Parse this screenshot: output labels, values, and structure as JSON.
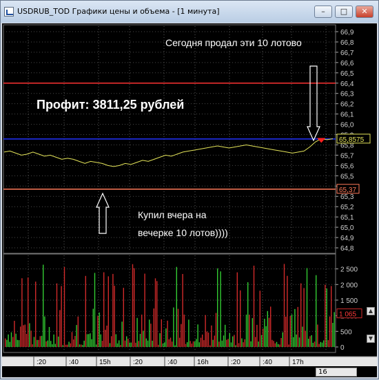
{
  "window": {
    "title": "USDRUB_TOD Графики цены и объема - [1 минута]",
    "buttons": {
      "minimize": "–",
      "maximize": "□",
      "close": "✕"
    }
  },
  "annotations": {
    "sold": "Сегодня продал эти 10 лотово",
    "profit": "Профит:  3811,25 рублей",
    "bought_line1": "Купил вчера на",
    "bought_line2": "вечерке 10 лотов))))"
  },
  "price_panel": {
    "y_ticks": [
      "66,9",
      "66,8",
      "66,7",
      "66,6",
      "66,5",
      "66,4",
      "66,3",
      "66,2",
      "66,1",
      "66,0",
      "65,9",
      "65,8",
      "65,7",
      "65,6",
      "65,5",
      "65,4",
      "65,3",
      "65,2",
      "65,1",
      "65,0",
      "64,9",
      "64,8"
    ],
    "current_price_label": "65,8575",
    "buy_level_label": "65,37",
    "sell_level": 66.4,
    "buy_level": 65.37,
    "current_price": 65.8575,
    "ylim": [
      64.8,
      66.9
    ]
  },
  "volume_panel": {
    "y_ticks": [
      "2 500",
      "2 000",
      "1 500",
      "1 000",
      "500",
      "0"
    ],
    "current_volume_label": "1 065",
    "ylim": [
      0,
      2800
    ]
  },
  "time_axis": {
    "labels": [
      ":20",
      ":40",
      "15h",
      ":20",
      ":40",
      "16h",
      ":20",
      ":40",
      "17h"
    ],
    "page_label": "16"
  },
  "colors": {
    "price_line": "#e6e65a",
    "sell_line": "#ff3333",
    "buy_line": "#ff7a5a",
    "current_line": "#2233ff",
    "volume_up": "#33cc33",
    "volume_down": "#d12a2a"
  },
  "chart_data": {
    "type": "line",
    "series": [
      {
        "values": [
          65.73,
          65.74,
          65.72,
          65.7,
          65.71,
          65.73,
          65.71,
          65.69,
          65.7,
          65.68,
          65.66,
          65.67,
          65.66,
          65.64,
          65.62,
          65.64,
          65.63,
          65.62,
          65.6,
          65.59,
          65.6,
          65.62,
          65.61,
          65.63,
          65.65,
          65.64,
          65.66,
          65.68,
          65.7,
          65.69,
          65.71,
          65.73,
          65.74,
          65.75,
          65.76,
          65.77,
          65.78,
          65.79,
          65.78,
          65.77,
          65.78,
          65.79,
          65.8,
          65.79,
          65.78,
          65.77,
          65.76,
          65.75,
          65.74,
          65.73,
          65.72,
          65.73,
          65.74,
          65.78,
          65.83,
          65.86,
          65.85,
          65.86
        ]
      }
    ],
    "ylim": [
      64.8,
      66.9
    ]
  }
}
